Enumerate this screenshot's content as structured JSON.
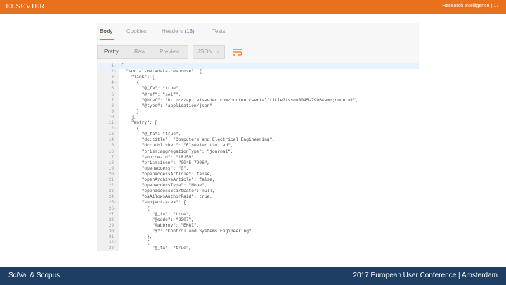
{
  "header": {
    "logo_text": "ELSEVIER",
    "right_text": "Research Intelligence | 17",
    "bar_color": "#e9711c"
  },
  "tabs": [
    {
      "label": "Body",
      "active": true
    },
    {
      "label": "Cookies",
      "active": false
    },
    {
      "label": "Headers",
      "count": "(13)",
      "active": false
    },
    {
      "label": "Tests",
      "active": false
    }
  ],
  "toolbar": {
    "pretty_label": "Pretty",
    "raw_label": "Raw",
    "preview_label": "Preview",
    "format_value": "JSON",
    "wrap_icon": "wrap-lines-icon"
  },
  "code_lines": [
    {
      "n": "1",
      "fold": "▾",
      "text": "{",
      "highlight": true
    },
    {
      "n": "2",
      "fold": "▾",
      "text": "  \"social-metadata-response\": {"
    },
    {
      "n": "3",
      "fold": "▾",
      "text": "    \"link\": ["
    },
    {
      "n": "4",
      "fold": "▾",
      "text": "      {"
    },
    {
      "n": "5",
      "fold": "",
      "text": "        \"@_fa\": \"true\","
    },
    {
      "n": "6",
      "fold": "",
      "text": "        \"@ref\": \"self\","
    },
    {
      "n": "7",
      "fold": "",
      "text": "        \"@href\": \"http://api.elsevier.com/content/serial/title?issn=0045-7906&amp;count=1\","
    },
    {
      "n": "8",
      "fold": "",
      "text": "        \"@type\": \"application/json\""
    },
    {
      "n": "9",
      "fold": "",
      "text": "      }"
    },
    {
      "n": "10",
      "fold": "",
      "text": "    ],"
    },
    {
      "n": "11",
      "fold": "▾",
      "text": "    \"entry\": ["
    },
    {
      "n": "12",
      "fold": "▾",
      "text": "      {"
    },
    {
      "n": "13",
      "fold": "",
      "text": "        \"@_fa\": \"true\","
    },
    {
      "n": "14",
      "fold": "",
      "text": "        \"dc:title\": \"Computers and Electrical Engineering\","
    },
    {
      "n": "15",
      "fold": "",
      "text": "        \"dc:publisher\": \"Elsevier Limited\","
    },
    {
      "n": "16",
      "fold": "",
      "text": "        \"prism:aggregationType\": \"journal\","
    },
    {
      "n": "17",
      "fold": "",
      "text": "        \"source-id\": \"18159\","
    },
    {
      "n": "18",
      "fold": "",
      "text": "        \"prism:issn\": \"0045-7906\","
    },
    {
      "n": "19",
      "fold": "",
      "text": "        \"openaccess\": \"0\","
    },
    {
      "n": "20",
      "fold": "",
      "text": "        \"openaccessArticle\": false,"
    },
    {
      "n": "21",
      "fold": "",
      "text": "        \"openArchiveArticle\": false,"
    },
    {
      "n": "22",
      "fold": "",
      "text": "        \"openaccessType\": \"None\","
    },
    {
      "n": "23",
      "fold": "",
      "text": "        \"openaccessStartDate\": null,"
    },
    {
      "n": "24",
      "fold": "",
      "text": "        \"oaAllowsAuthorPaid\": true,"
    },
    {
      "n": "25",
      "fold": "▾",
      "text": "        \"subject-area\": ["
    },
    {
      "n": "26",
      "fold": "▾",
      "text": "          {"
    },
    {
      "n": "27",
      "fold": "",
      "text": "            \"@_fa\": \"true\","
    },
    {
      "n": "28",
      "fold": "",
      "text": "            \"@code\": \"2207\","
    },
    {
      "n": "29",
      "fold": "",
      "text": "            \"@abbrev\": \"ENGI\","
    },
    {
      "n": "30",
      "fold": "",
      "text": "            \"$\": \"Control and Systems Engineering\""
    },
    {
      "n": "31",
      "fold": "",
      "text": "          },"
    },
    {
      "n": "32",
      "fold": "▾",
      "text": "          {"
    },
    {
      "n": "33",
      "fold": "",
      "text": "            \"@_fa\": \"true\","
    }
  ],
  "footer": {
    "brand_text": "SciVal & Scopus",
    "conference_text": "2017 European User Conference | Amsterdam",
    "bar_color": "#1e3f63"
  }
}
